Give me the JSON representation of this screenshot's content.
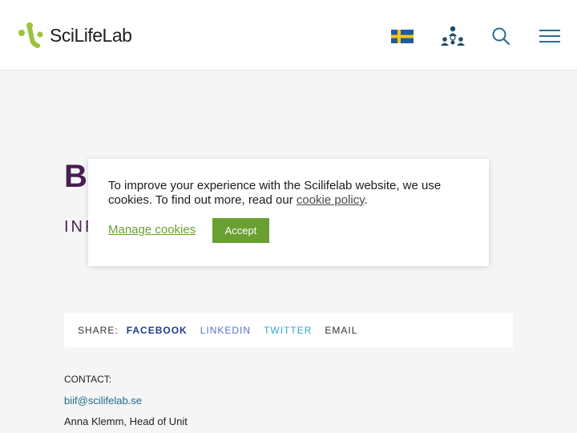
{
  "header": {
    "logo_text": "SciLifeLab",
    "icons": [
      "swedish-flag-icon",
      "people-network-icon",
      "search-icon",
      "menu-icon"
    ]
  },
  "hero": {
    "title_visible": "Bi",
    "subtitle_visible": "INF"
  },
  "cookie_banner": {
    "text_before_link": "To improve your experience with the Scilifelab website, we use cookies. To find out more, read our ",
    "policy_link": "cookie policy",
    "text_after_link": ".",
    "manage_label": "Manage cookies",
    "accept_label": "Accept"
  },
  "share": {
    "label": "SHARE:",
    "facebook": "FACEBOOK",
    "linkedin": "LINKEDIN",
    "twitter": "TWITTER",
    "email": "EMAIL"
  },
  "contact": {
    "label": "CONTACT:",
    "email": "biif@scilifelab.se",
    "name": "Anna Klemm, Head of Unit"
  },
  "colors": {
    "brand_green": "#6aa031",
    "heading_purple": "#491f53",
    "facebook_blue": "#1f3b8f",
    "twitter_blue": "#2fa8d8"
  }
}
